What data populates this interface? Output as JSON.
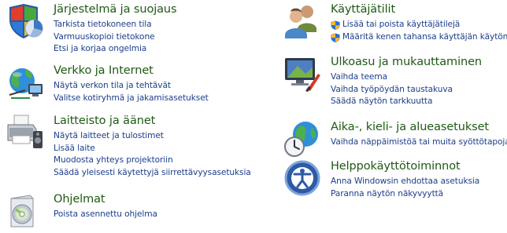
{
  "categories": {
    "system_security": {
      "title": "Järjestelmä ja suojaus",
      "links": [
        "Tarkista tietokoneen tila",
        "Varmuuskopioi tietokone",
        "Etsi ja korjaa ongelmia"
      ]
    },
    "network": {
      "title": "Verkko ja Internet",
      "links": [
        "Näytä verkon tila ja tehtävät",
        "Valitse kotiryhmä ja jakamisasetukset"
      ]
    },
    "hardware": {
      "title": "Laitteisto ja äänet",
      "links": [
        "Näytä laitteet ja tulostimet",
        "Lisää laite",
        "Muodosta yhteys projektoriin",
        "Säädä yleisesti käytettyjä siirrettävyysasetuksia"
      ]
    },
    "programs": {
      "title": "Ohjelmat",
      "links": [
        "Poista asennettu ohjelma"
      ]
    },
    "user_accounts": {
      "title": "Käyttäjätilit",
      "links": [
        "Lisää tai poista käyttäjätilejä",
        "Määritä kenen tahansa käyttäjän käytön"
      ]
    },
    "appearance": {
      "title": "Ulkoasu ja mukauttaminen",
      "links": [
        "Vaihda teema",
        "Vaihda työpöydän taustakuva",
        "Säädä näytön tarkkuutta"
      ]
    },
    "clock_region": {
      "title": "Aika-, kieli- ja alueasetukset",
      "links": [
        "Vaihda näppäimistöä tai muita syöttötapoja"
      ]
    },
    "ease_of_access": {
      "title": "Helppokäyttötoiminnot",
      "links": [
        "Anna Windowsin ehdottaa asetuksia",
        "Paranna näytön näkyvyyttä"
      ]
    }
  },
  "colors": {
    "title": "#1e5a13",
    "link": "#1d3e8a",
    "background": "#ffffff"
  },
  "icons": {
    "system_security": "shield-flag-chart-icon",
    "network": "globe-network-icon",
    "hardware": "printer-speaker-icon",
    "programs": "software-box-cd-icon",
    "user_accounts": "users-icon",
    "appearance": "monitor-paint-icon",
    "clock_region": "globe-clock-icon",
    "ease_of_access": "ease-of-access-icon",
    "uac": "uac-shield-icon"
  }
}
